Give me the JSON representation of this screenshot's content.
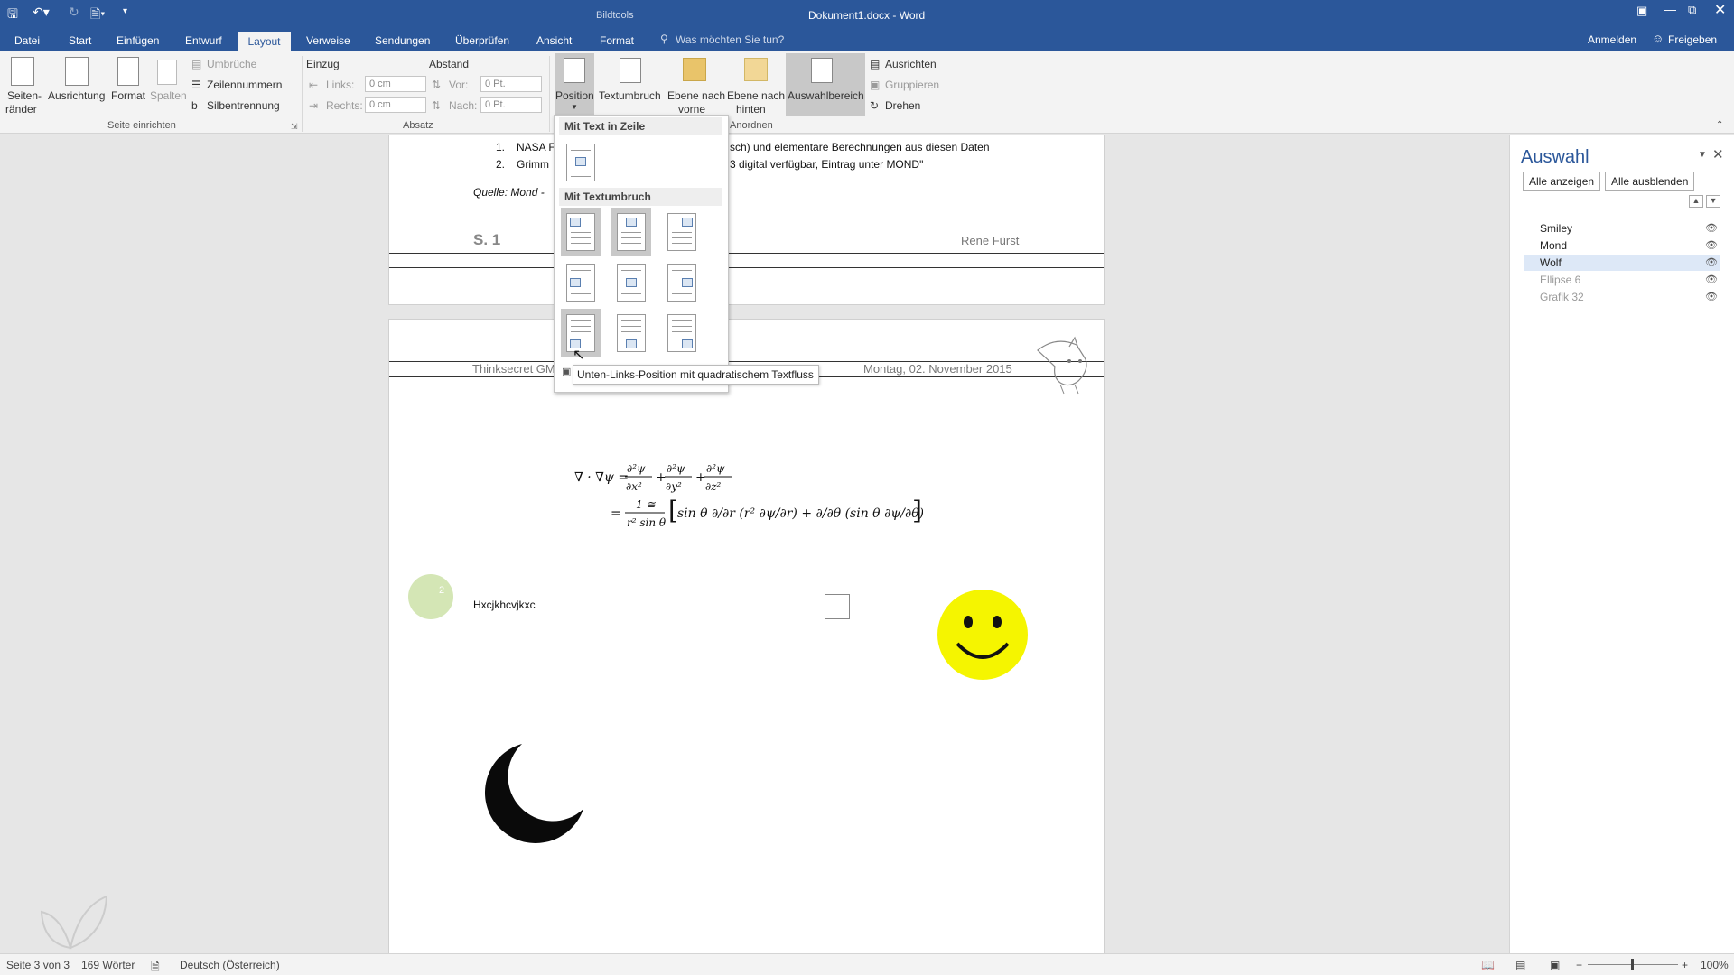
{
  "titlebar": {
    "context_tab": "Bildtools",
    "document_title": "Dokument1.docx - Word"
  },
  "tabs": [
    {
      "label": "Datei"
    },
    {
      "label": "Start"
    },
    {
      "label": "Einfügen"
    },
    {
      "label": "Entwurf"
    },
    {
      "label": "Layout"
    },
    {
      "label": "Verweise"
    },
    {
      "label": "Sendungen"
    },
    {
      "label": "Überprüfen"
    },
    {
      "label": "Ansicht"
    },
    {
      "label": "Format"
    }
  ],
  "tellme": "Was möchten Sie tun?",
  "account": {
    "signin": "Anmelden",
    "share": "Freigeben"
  },
  "ribbon": {
    "seite": {
      "margins1": "Seiten-",
      "margins2": "ränder",
      "orientation": "Ausrichtung",
      "format": "Format",
      "columns": "Spalten",
      "breaks": "Umbrüche",
      "linenumbers": "Zeilennummern",
      "hyphenation": "Silbentrennung",
      "group": "Seite einrichten"
    },
    "absatz": {
      "indent": "Einzug",
      "spacing": "Abstand",
      "left": "Links:",
      "right": "Rechts:",
      "before": "Vor:",
      "after": "Nach:",
      "left_val": "0 cm",
      "right_val": "0 cm",
      "before_val": "0 Pt.",
      "after_val": "0 Pt.",
      "group": "Absatz"
    },
    "anordnen": {
      "position": "Position",
      "wrap": "Textumbruch",
      "forward1": "Ebene nach",
      "forward2": "vorne",
      "backward1": "Ebene nach",
      "backward2": "hinten",
      "selection": "Auswahlbereich",
      "align": "Ausrichten",
      "group_btn": "Gruppieren",
      "rotate": "Drehen",
      "group": "Anordnen"
    }
  },
  "document": {
    "list1_num": "1.",
    "list1_a": "NASA F",
    "list1_b": "sch) und elementare Berechnungen aus diesen Daten",
    "list2_num": "2.",
    "list2_a": "Grimm",
    "list2_b": "3 digital verfügbar, Eintrag unter MOND\"",
    "source": "Quelle: Mond -",
    "page_num": "S. 1",
    "author": "Rene Fürst",
    "header_company": "Thinksecret GM",
    "header_date": "Montag, 02. November 2015",
    "circle_num": "2",
    "body_text": "Hxcjkhcvjkxc"
  },
  "dropdown": {
    "section1": "Mit Text in Zeile",
    "section2": "Mit Textumbruch"
  },
  "tooltip": "Unten-Links-Position mit quadratischem Textfluss",
  "selection_pane": {
    "title": "Auswahl",
    "show_all": "Alle anzeigen",
    "hide_all": "Alle ausblenden",
    "items": [
      {
        "label": "Smiley"
      },
      {
        "label": "Mond"
      },
      {
        "label": "Wolf"
      },
      {
        "label": "Ellipse 6"
      },
      {
        "label": "Grafik 32"
      }
    ]
  },
  "status": {
    "page": "Seite 3 von 3",
    "words": "169 Wörter",
    "language": "Deutsch (Österreich)",
    "zoom": "100%"
  },
  "colors": {
    "accent": "#2b579a",
    "smiley": "#f5f500",
    "selection": "#dde8f7"
  }
}
